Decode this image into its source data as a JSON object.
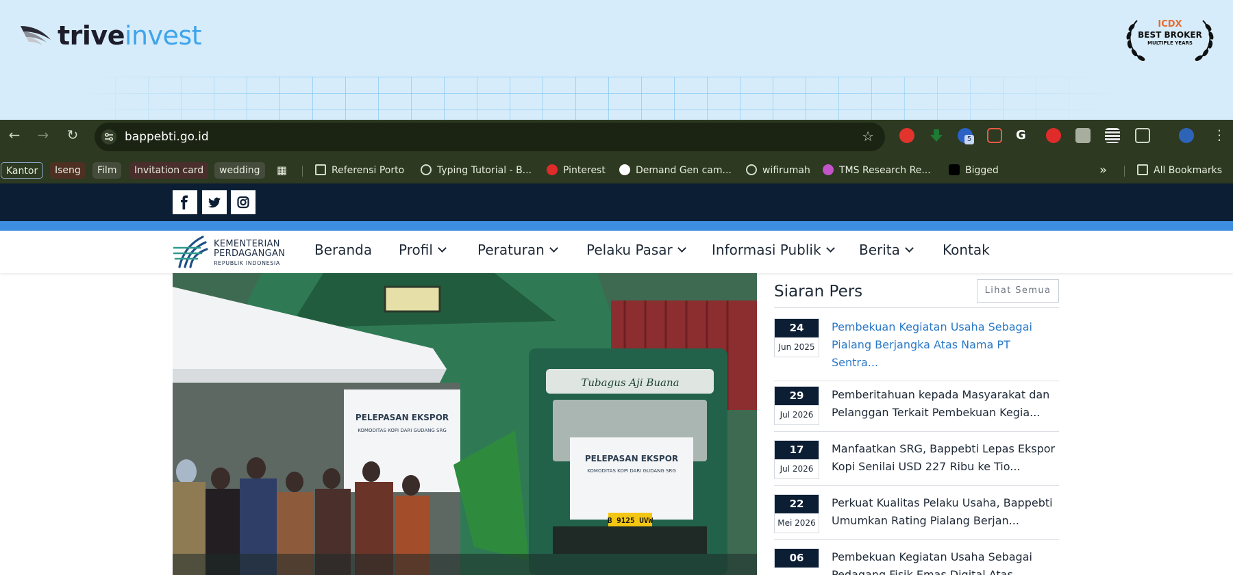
{
  "banner": {
    "brand_part1": "trive",
    "brand_part2": "invest",
    "award_line1": "ICDX",
    "award_line2": "BEST BROKER",
    "award_line3": "MULTIPLE YEARS"
  },
  "browser": {
    "url": "bappebti.go.id",
    "extension_badge": "5",
    "bookmarks": {
      "chips": [
        "Kantor",
        "Iseng",
        "Film",
        "Invitation card",
        "wedding"
      ],
      "items": [
        "Referensi Porto",
        "Typing Tutorial - B...",
        "Pinterest",
        "Demand Gen cam...",
        "wifirumah",
        "TMS Research Re...",
        "Bigged"
      ],
      "more": "»",
      "all_bookmarks": "All Bookmarks"
    }
  },
  "site": {
    "social": [
      "f",
      "t",
      "ig"
    ],
    "logo": {
      "line1": "KEMENTERIAN",
      "line2": "PERDAGANGAN",
      "line3": "REPUBLIK INDONESIA"
    },
    "menu": [
      "Beranda",
      "Profil",
      "Peraturan",
      "Pelaku Pasar",
      "Informasi Publik",
      "Berita",
      "Kontak"
    ],
    "hero": {
      "banner_title": "PELEPASAN EKSPOR",
      "banner_subtitle": "KOMODITAS KOPI DARI GUDANG SRG",
      "truck_banner_title": "PELEPASAN EKSPOR",
      "truck_banner_subtitle": "KOMODITAS KOPI DARI GUDANG SRG",
      "truck_name": "Tubagus Aji Buana",
      "plate": "B 9125 UVW"
    },
    "press": {
      "title": "Siaran Pers",
      "see_all": "Lihat Semua",
      "items": [
        {
          "day": "24",
          "month": "Jun 2025",
          "text": "Pembekuan Kegiatan Usaha Sebagai Pialang Berjangka Atas Nama PT Sentra..."
        },
        {
          "day": "29",
          "month": "Jul 2026",
          "text": "Pemberitahuan kepada Masyarakat dan Pelanggan Terkait Pembekuan Kegia..."
        },
        {
          "day": "17",
          "month": "Jul 2026",
          "text": "Manfaatkan SRG, Bappebti Lepas Ekspor Kopi Senilai USD 227 Ribu ke Tio..."
        },
        {
          "day": "22",
          "month": "Mei 2026",
          "text": "Perkuat Kualitas Pelaku Usaha, Bappebti Umumkan Rating Pialang Berjan..."
        },
        {
          "day": "06",
          "month": "",
          "text": "Pembekuan Kegiatan Usaha Sebagai Pedagang Fisik Emas Digital Atas Nama..."
        }
      ]
    }
  }
}
